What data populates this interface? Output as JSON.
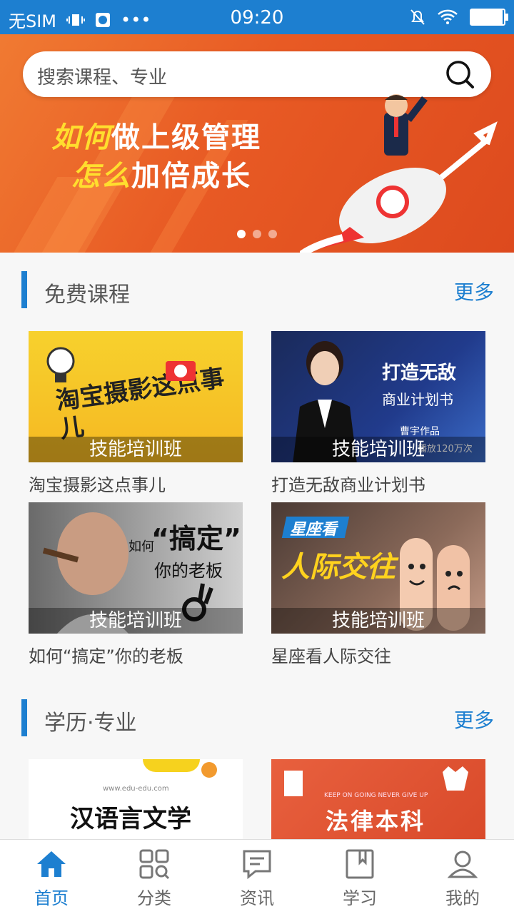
{
  "status_bar": {
    "carrier": "无SIM",
    "time": "09:20",
    "battery_level": 0.95
  },
  "banner": {
    "search_placeholder": "搜索课程、专业",
    "line1_highlight": "如何",
    "line1_rest": "做上级管理",
    "line2_highlight": "怎么",
    "line2_rest": "加倍成长",
    "page_count": 3,
    "active_page": 1
  },
  "free_courses": {
    "title": "免费课程",
    "more": "更多",
    "items": [
      {
        "title": "淘宝摄影这点事儿",
        "tag": "技能培训班",
        "art_text": "淘宝摄影这点事儿"
      },
      {
        "title": "打造无敌商业计划书",
        "tag": "技能培训班",
        "art_line1": "打造无敌",
        "art_line2": "商业计划书",
        "art_line3": "曹宇作品",
        "art_line4": "播放120万次"
      },
      {
        "title": "如何“搞定”你的老板",
        "tag": "技能培训班",
        "art_line1": "如何",
        "art_line2": "“搞定”",
        "art_line3": "你的老板"
      },
      {
        "title": "星座看人际交往",
        "tag": "技能培训班",
        "art_line1": "星座看",
        "art_line2": "人际交往"
      }
    ]
  },
  "degree": {
    "title": "学历·专业",
    "more": "更多",
    "items": [
      {
        "art_small": "www.edu-edu.com",
        "art_text": "汉语言文学"
      },
      {
        "art_small": "KEEP ON GOING NEVER GIVE UP",
        "art_text": "法律本科"
      }
    ]
  },
  "nav": {
    "items": [
      {
        "label": "首页",
        "icon": "home-icon",
        "active": true
      },
      {
        "label": "分类",
        "icon": "category-icon"
      },
      {
        "label": "资讯",
        "icon": "news-icon"
      },
      {
        "label": "学习",
        "icon": "study-icon"
      },
      {
        "label": "我的",
        "icon": "profile-icon"
      }
    ],
    "active_color": "#1d7fd0"
  },
  "colors": {
    "brand": "#1d7fd0",
    "banner": "#e85a24"
  }
}
